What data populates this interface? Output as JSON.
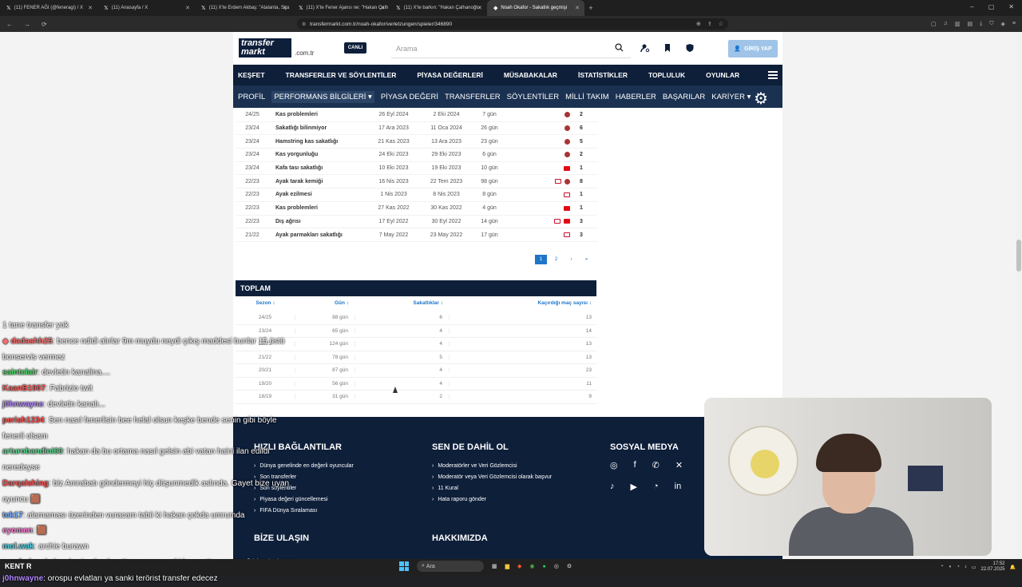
{
  "browser": {
    "tabs": [
      {
        "label": "(11) FENER AĞI (@feneragi) / X",
        "icon": "x-icon"
      },
      {
        "label": "(11) Anasayfa / X",
        "icon": "x-icon"
      },
      {
        "label": "(11) X'te Erdem Akbaş: \"Atalanta, Sça",
        "icon": "x-icon"
      },
      {
        "label": "(11) X'te Fener Ajansı ne: \"Hakan Çalh",
        "icon": "x-icon"
      },
      {
        "label": "(11) X'te barkın: \"Hakan Çalhanoğlu",
        "icon": "x-icon"
      },
      {
        "label": "Noah Okafor - Sakatlık geçmişi",
        "icon": "transfermarkt-icon",
        "active": true
      }
    ],
    "url": "transfermarkt.com.tr/noah-okafor/verletzungen/spieler/346890"
  },
  "header": {
    "logo_top": "transfer",
    "logo_bottom": "markt",
    "logo_tld": ".com.tr",
    "live_label": "CANLI",
    "search_placeholder": "Arama",
    "login_label": "GİRİŞ YAP"
  },
  "main_nav": [
    "KEŞFET",
    "TRANSFERLER VE SÖYLENTİLER",
    "PİYASA DEĞERLERİ",
    "MÜSABAKALAR",
    "İSTATİSTİKLER",
    "TOPLULUK",
    "OYUNLAR"
  ],
  "sub_nav": [
    {
      "label": "PROFİL"
    },
    {
      "label": "PERFORMANS BİLGİLERİ ▾",
      "highlight": true
    },
    {
      "label": "PİYASA DEĞERİ"
    },
    {
      "label": "TRANSFERLER"
    },
    {
      "label": "SÖYLENTİLER"
    },
    {
      "label": "MİLLİ TAKIM"
    },
    {
      "label": "HABERLER"
    },
    {
      "label": "BAŞARILAR"
    },
    {
      "label": "KARİYER ▾"
    }
  ],
  "injuries": [
    {
      "season": "24/25",
      "injury": "Kas problemleri",
      "from": "26 Eyl 2024",
      "to": "2 Eki 2024",
      "days": "7 gün",
      "flags": [
        "club"
      ],
      "games": "2"
    },
    {
      "season": "23/24",
      "injury": "Sakatlığı bilinmiyor",
      "from": "17 Ara 2023",
      "to": "11 Oca 2024",
      "days": "26 gün",
      "flags": [
        "club"
      ],
      "games": "6"
    },
    {
      "season": "23/24",
      "injury": "Hamstring kas sakatlığı",
      "from": "21 Kas 2023",
      "to": "13 Ara 2023",
      "days": "23 gün",
      "flags": [
        "club"
      ],
      "games": "5"
    },
    {
      "season": "23/24",
      "injury": "Kas yorgunluğu",
      "from": "24 Eki 2023",
      "to": "29 Eki 2023",
      "days": "6 gün",
      "flags": [
        "club"
      ],
      "games": "2"
    },
    {
      "season": "23/24",
      "injury": "Kafa tası sakatlığı",
      "from": "10 Eki 2023",
      "to": "19 Eki 2023",
      "days": "10 gün",
      "flags": [
        "tr"
      ],
      "games": "1"
    },
    {
      "season": "22/23",
      "injury": "Ayak tarak kemiği",
      "from": "16 Nis 2023",
      "to": "22 Tem 2023",
      "days": "98 gün",
      "flags": [
        "en",
        "club"
      ],
      "games": "8"
    },
    {
      "season": "22/23",
      "injury": "Ayak ezilmesi",
      "from": "1 Nis 2023",
      "to": "8 Nis 2023",
      "days": "8 gün",
      "flags": [
        "en"
      ],
      "games": "1"
    },
    {
      "season": "22/23",
      "injury": "Kas problemleri",
      "from": "27 Kas 2022",
      "to": "30 Kas 2022",
      "days": "4 gün",
      "flags": [
        "tr"
      ],
      "games": "1"
    },
    {
      "season": "22/23",
      "injury": "Dış ağrısı",
      "from": "17 Eyl 2022",
      "to": "30 Eyl 2022",
      "days": "14 gün",
      "flags": [
        "en",
        "tr"
      ],
      "games": "3"
    },
    {
      "season": "21/22",
      "injury": "Ayak parmakları sakatlığı",
      "from": "7 May 2022",
      "to": "23 May 2022",
      "days": "17 gün",
      "flags": [
        "en"
      ],
      "games": "3"
    }
  ],
  "pagination": {
    "pages": [
      "1",
      "2",
      "›",
      "»"
    ],
    "current": "1"
  },
  "totals": {
    "title": "TOPLAM",
    "headers": {
      "season": "Sezon ↕",
      "days": "Gün ↕",
      "injuries": "Sakatlıklar ↕",
      "missed": "Kaçırdığı maç sayısı ↕"
    },
    "rows": [
      {
        "season": "24/25",
        "days": "88 gün",
        "injuries": "6",
        "missed": "13"
      },
      {
        "season": "23/24",
        "days": "65 gün",
        "injuries": "4",
        "missed": "14"
      },
      {
        "season": "22/23",
        "days": "124 gün",
        "injuries": "4",
        "missed": "13"
      },
      {
        "season": "21/22",
        "days": "78 gün",
        "injuries": "5",
        "missed": "13"
      },
      {
        "season": "20/21",
        "days": "87 gün",
        "injuries": "4",
        "missed": "23"
      },
      {
        "season": "19/20",
        "days": "56 gün",
        "injuries": "4",
        "missed": "11"
      },
      {
        "season": "18/19",
        "days": "31 gün",
        "injuries": "2",
        "missed": "9"
      }
    ]
  },
  "footer": {
    "col1_title": "HIZLI BAĞLANTILAR",
    "col1_links": [
      "Dünya genelinde en değerli oyuncular",
      "Son transferler",
      "Son söylentiler",
      "Piyasa değeri güncellemesi",
      "FIFA Dünya Sıralaması"
    ],
    "col2_title": "SEN DE DAHİL OL",
    "col2_links": [
      "Moderatörler ve Veri Gözlemcisi",
      "Moderatör veya Veri Gözlemcisi olarak başvur",
      "11 Kural",
      "Hata raporu gönder"
    ],
    "col3_title": "SOSYAL MEDYA",
    "contact_title": "BİZE ULAŞIN",
    "about_title": "HAKKIMIZDA"
  },
  "chat": [
    {
      "user": "",
      "color": "#ffffff",
      "message": "1 tane transfer yok"
    },
    {
      "user": "◆ dadashh25",
      "color": "#ff6b6b",
      "message": ": bence ndidi alırlar 9m muydu neydi çıkış maddesi bunlar 15 üstü"
    },
    {
      "user": "",
      "color": "#ffffff",
      "message": "bonservis vermez"
    },
    {
      "user": "saintclair",
      "color": "#4cd964",
      "message": ": devletin kanalina...."
    },
    {
      "user": "KaanB1907",
      "color": "#ff5555",
      "message": ": Fabrizio twit"
    },
    {
      "user": "j0hnwayne",
      "color": "#b388ff",
      "message": ": devletin kanalı..."
    },
    {
      "user": "perish1234",
      "color": "#ff4d4d",
      "message": ": Sen nasıl fenerlisin bee helal olsun keşke bende senin gibi böyle"
    },
    {
      "user": "",
      "color": "#ffffff",
      "message": "fenerli olsam"
    },
    {
      "user": "arturobandini60",
      "color": "#58d68d",
      "message": ": hakan da bu ortama nasıl gelsin abi vatan haini ilan edildi"
    },
    {
      "user": "",
      "color": "#ffffff",
      "message": "neredeyse"
    },
    {
      "user": "Darqalshing",
      "color": "#ff4d4d",
      "message": ": biz Amrabatı göndermeyi hiç düşunmedik aslında. Gayet bize uyan"
    },
    {
      "user": "",
      "color": "#ffffff",
      "message": "oyuncu 🟫"
    },
    {
      "user": "tck17",
      "color": "#6fa8ff",
      "message": ": alamaması üzerinden vuracam tabii ki hakan çokda umrumda"
    },
    {
      "user": "eyomen",
      "color": "#ff7bd5",
      "message": ": 🟫"
    },
    {
      "user": "mol.wak",
      "color": "#4dd0e1",
      "message": ": archie burawn"
    },
    {
      "user": "pandarico",
      "color": "#c39bd3",
      "message": ": hakan kesin olarak yattı mı sence peki bu saatten sonra @biradetbugra"
    },
    {
      "user": "j0hnwayne",
      "color": "#b388ff",
      "message": ": orospu evlatları ya sanki terörist transfer edecez"
    }
  ],
  "taskbar": {
    "weather": "KENT R",
    "search": "Ara",
    "time": "17:52",
    "date": "22.07.2025"
  }
}
